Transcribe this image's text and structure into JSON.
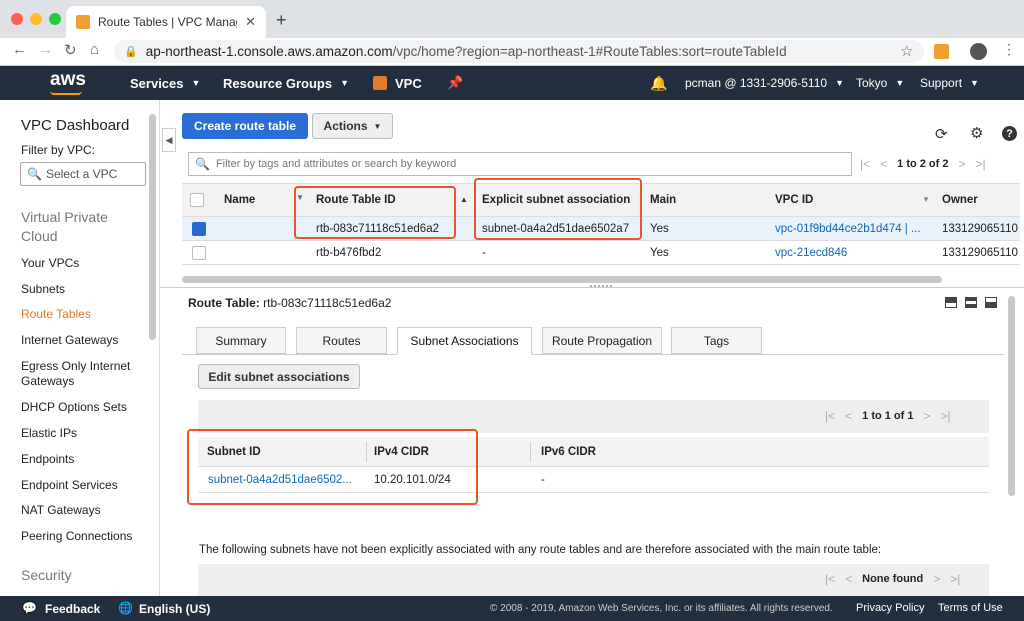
{
  "browser": {
    "tab_title": "Route Tables | VPC Manageme",
    "url_host": "ap-northeast-1.console.aws.amazon.com",
    "url_path": "/vpc/home?region=ap-northeast-1#RouteTables:sort=routeTableId",
    "colors": {
      "close": "#ff5f57",
      "minimize": "#febc2e",
      "maximize": "#28c840"
    }
  },
  "awsnav": {
    "logo": "aws",
    "services": "Services",
    "resource_groups": "Resource Groups",
    "vpc": "VPC",
    "account": "pcman @ 1331-2906-5110",
    "region": "Tokyo",
    "support": "Support"
  },
  "sidebar": {
    "title": "VPC Dashboard",
    "filter_label": "Filter by VPC:",
    "select_placeholder": "Select a VPC",
    "section_vpc": "Virtual Private Cloud",
    "items": [
      "Your VPCs",
      "Subnets",
      "Route Tables",
      "Internet Gateways",
      "Egress Only Internet Gateways",
      "DHCP Options Sets",
      "Elastic IPs",
      "Endpoints",
      "Endpoint Services",
      "NAT Gateways",
      "Peering Connections"
    ],
    "active_item": "Route Tables",
    "section_security": "Security"
  },
  "toolbar": {
    "create": "Create route table",
    "actions": "Actions"
  },
  "search": {
    "placeholder": "Filter by tags and attributes or search by keyword"
  },
  "pager": {
    "range": "1 to 2 of 2"
  },
  "table": {
    "columns": [
      "Name",
      "Route Table ID",
      "Explicit subnet association",
      "Main",
      "VPC ID",
      "Owner"
    ],
    "rows": [
      {
        "name": "",
        "id": "rtb-083c71118c51ed6a2",
        "explicit": "subnet-0a4a2d51dae6502a7",
        "main": "Yes",
        "vpc": "vpc-01f9bd44ce2b1d474 | ...",
        "owner": "133129065110",
        "selected": true
      },
      {
        "name": "",
        "id": "rtb-b476fbd2",
        "explicit": "-",
        "main": "Yes",
        "vpc": "vpc-21ecd846",
        "owner": "133129065110",
        "selected": false
      }
    ]
  },
  "detail": {
    "label": "Route Table:",
    "id": "rtb-083c71118c51ed6a2",
    "tabs": [
      "Summary",
      "Routes",
      "Subnet Associations",
      "Route Propagation",
      "Tags"
    ],
    "active_tab": "Subnet Associations",
    "edit_button": "Edit subnet associations",
    "pager": "1 to 1 of 1",
    "columns": [
      "Subnet ID",
      "IPv4 CIDR",
      "IPv6 CIDR"
    ],
    "rows": [
      {
        "subnet": "subnet-0a4a2d51dae6502...",
        "ipv4": "10.20.101.0/24",
        "ipv6": "-"
      }
    ],
    "note": "The following subnets have not been explicitly associated with any route tables and are therefore associated with the main route table:",
    "pager2": "None found"
  },
  "footer": {
    "feedback": "Feedback",
    "language": "English (US)",
    "copyright": "© 2008 - 2019, Amazon Web Services, Inc. or its affiliates. All rights reserved.",
    "privacy": "Privacy Policy",
    "terms": "Terms of Use"
  },
  "colors": {
    "aws_navy": "#232f3e",
    "primary_blue": "#2b6fd6",
    "highlight": "#e8542b",
    "link": "#1166bb"
  }
}
